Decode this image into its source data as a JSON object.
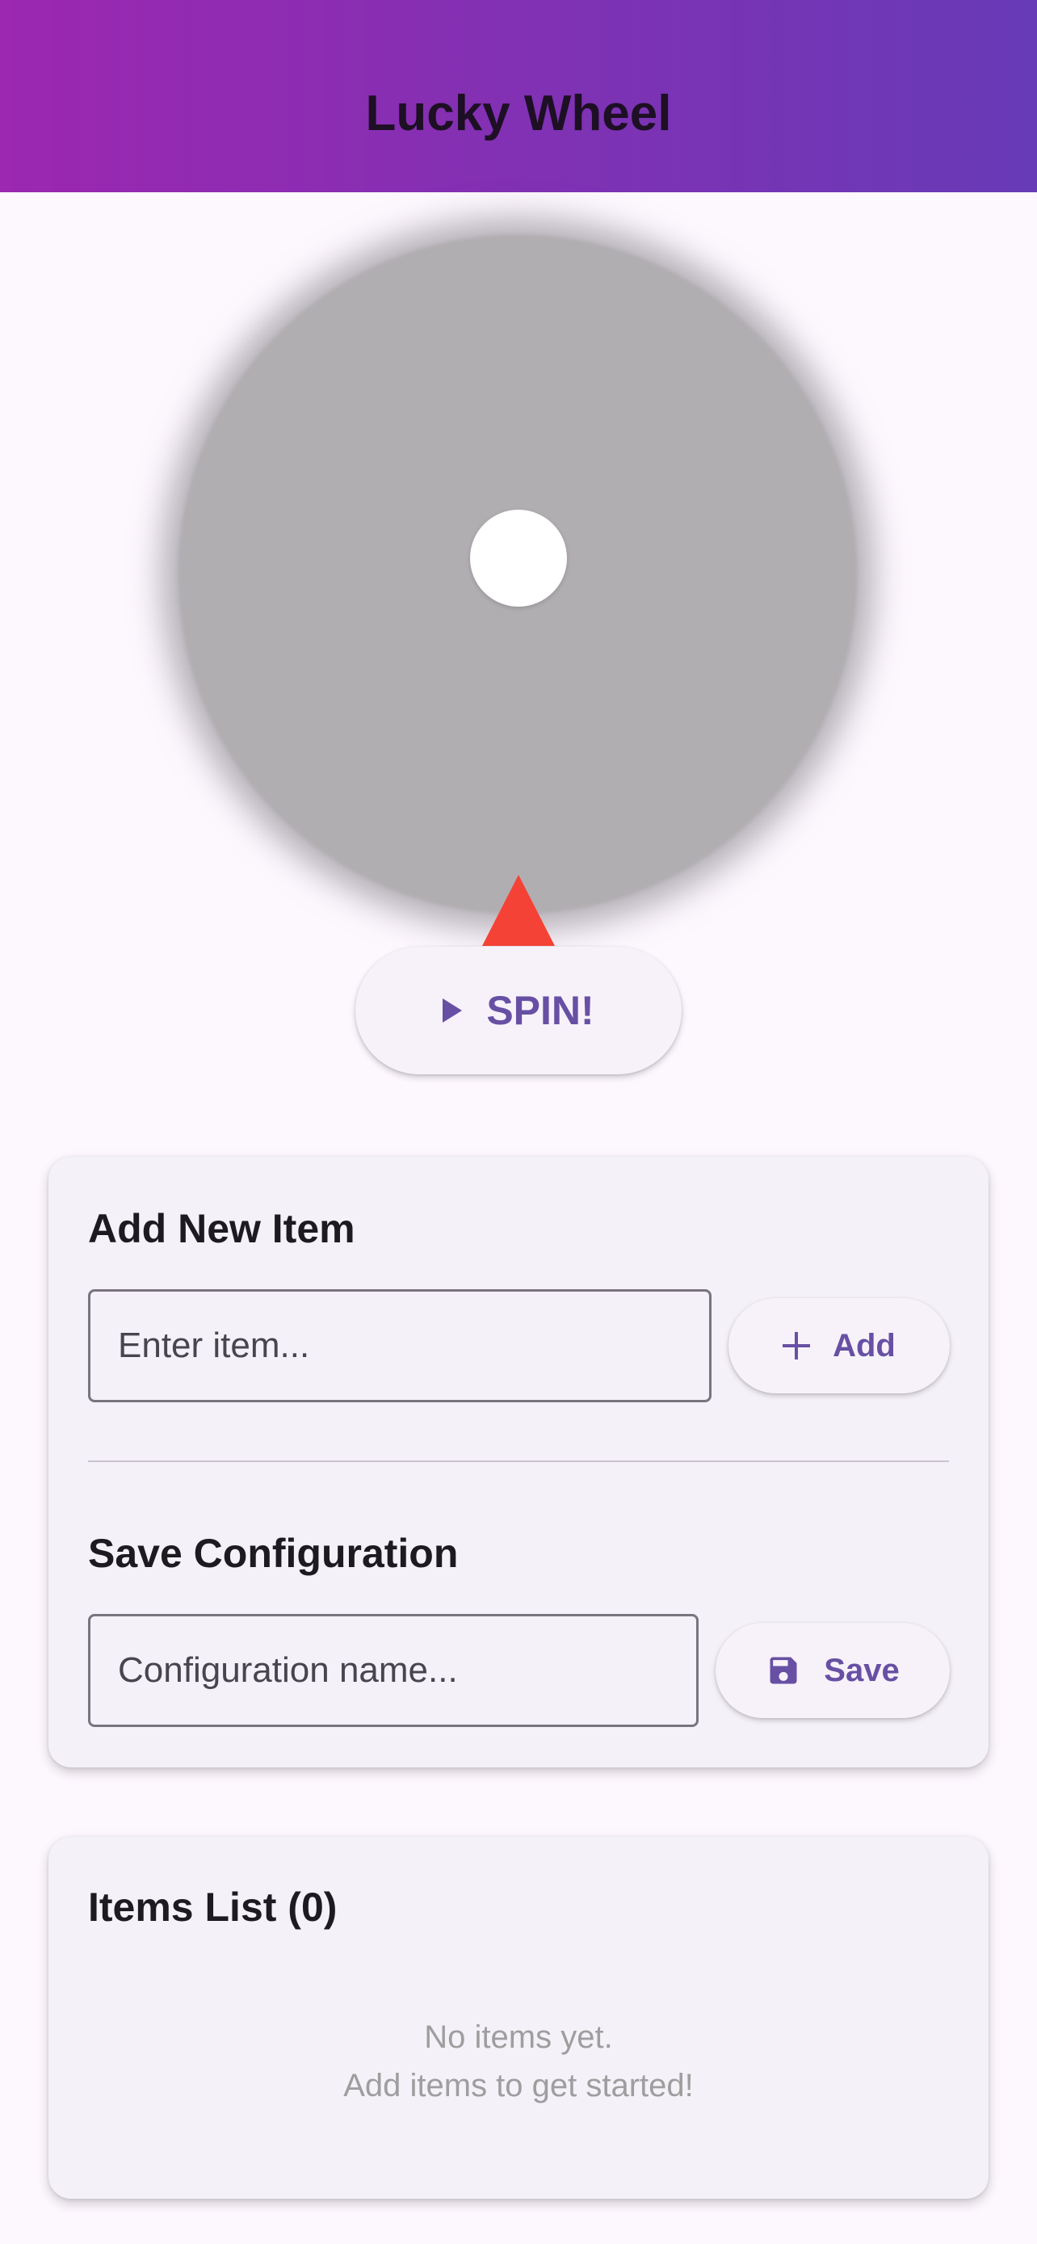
{
  "app": {
    "title": "Lucky Wheel"
  },
  "wheel": {
    "spin_label": "SPIN!",
    "pointer_color": "#f44336"
  },
  "add_item": {
    "title": "Add New Item",
    "input_value": "",
    "input_placeholder": "Enter item...",
    "button_label": "Add"
  },
  "save_config": {
    "title": "Save Configuration",
    "input_value": "",
    "input_placeholder": "Configuration name...",
    "button_label": "Save"
  },
  "items_list": {
    "title": "Items List (0)",
    "empty_line1": "No items yet.",
    "empty_line2": "Add items to get started!"
  },
  "colors": {
    "accent": "#6750a4",
    "header_gradient_start": "#9c27b0",
    "header_gradient_end": "#673ab7"
  },
  "icons": {
    "spin": "play-icon",
    "add": "plus-icon",
    "save": "floppy-disk-icon"
  }
}
